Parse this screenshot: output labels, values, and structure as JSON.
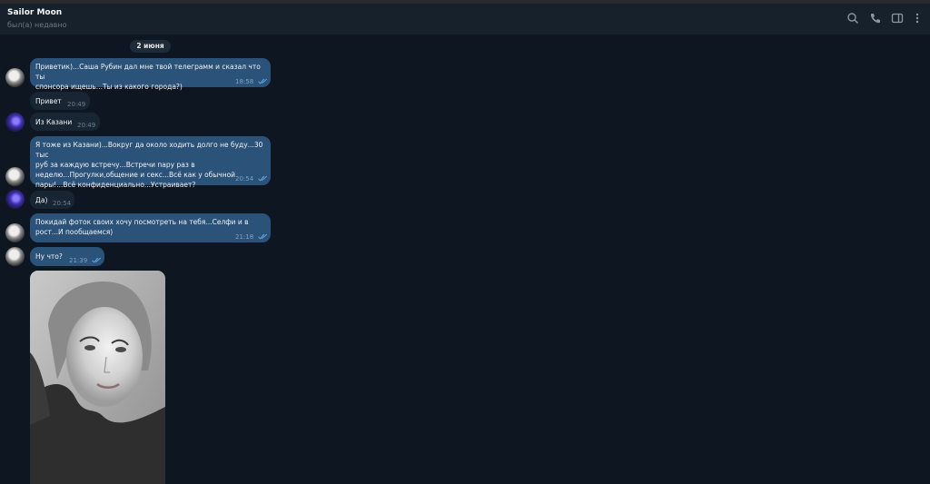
{
  "chat": {
    "title": "Sailor Moon",
    "status": "был(а) недавно"
  },
  "header_icons": [
    "search-icon",
    "phone-icon",
    "sidebar-toggle-icon",
    "more-vertical-icon"
  ],
  "date_separator": "2 июня",
  "messages": [
    {
      "direction": "out",
      "lines": [
        "Приветик)...Саша Рубин дал мне твой телеграмм и сказал что ты",
        "спонсора ищешь...Ты из какого города?)"
      ],
      "time": "18:58"
    },
    {
      "direction": "in",
      "lines": [
        "Привет"
      ],
      "time": "20:49"
    },
    {
      "direction": "in",
      "lines": [
        "Из Казани"
      ],
      "time": "20:49"
    },
    {
      "direction": "out",
      "lines": [
        "Я тоже из Казани)...Вокруг да около ходить долго не буду...30 тыс",
        "руб за каждую встречу...Встречи пару раз в",
        "неделю...Прогулки,общение и секс...Всё как у обычной",
        "пары!...Всё конфиденциально...Устраивает?"
      ],
      "time": "20:54"
    },
    {
      "direction": "in",
      "lines": [
        "Да)"
      ],
      "time": "20:54"
    },
    {
      "direction": "out",
      "lines": [
        "Покидай фоток своих хочу посмотреть на тебя...Селфи и в",
        "рост...И пообщаемся)"
      ],
      "time": "21:18"
    },
    {
      "direction": "out",
      "lines": [
        "Ну что?"
      ],
      "time": "21:39"
    }
  ],
  "photo": {
    "description_icon": "photo-message"
  },
  "colors": {
    "background": "#0e1621",
    "header": "#17212b",
    "outgoing_bubble": "#2b5278",
    "incoming_bubble": "#182533",
    "read_ticks": "#5fa8e6"
  }
}
